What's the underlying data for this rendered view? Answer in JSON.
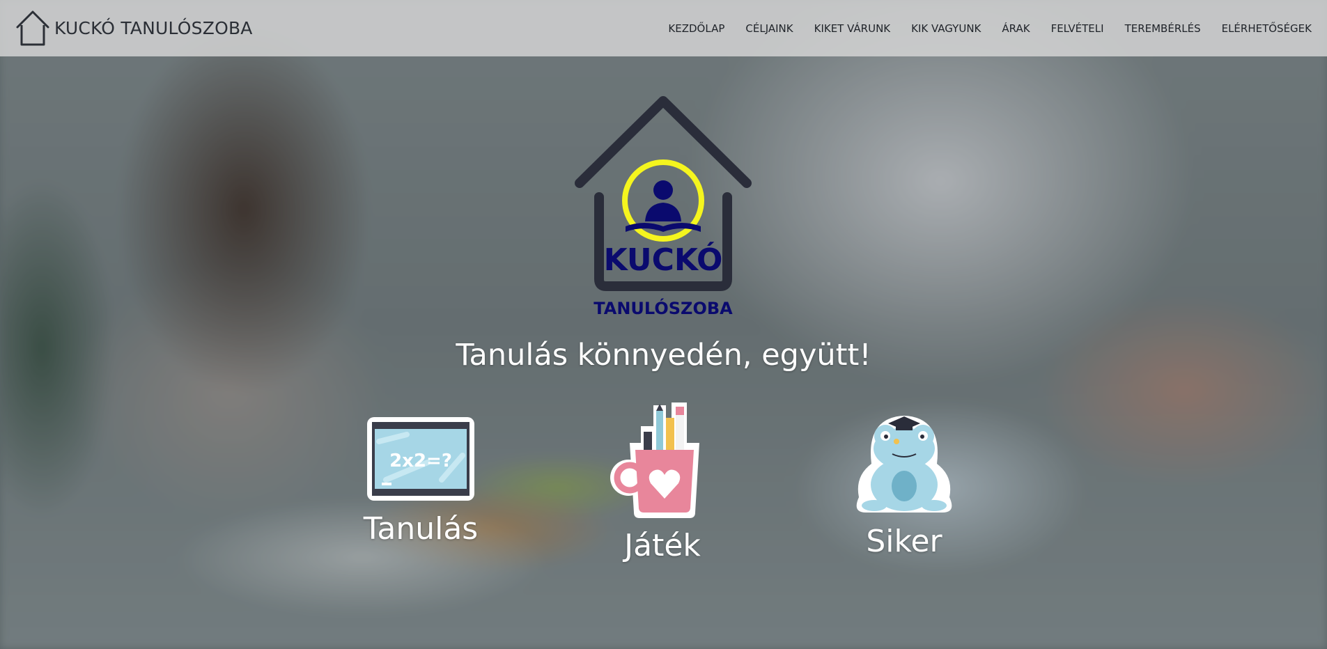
{
  "brand": {
    "name": "KUCKÓ TANULÓSZOBA",
    "icon": "house-icon"
  },
  "nav": {
    "items": [
      {
        "label": "KEZDŐLAP"
      },
      {
        "label": "CÉLJAINK"
      },
      {
        "label": "KIKET VÁRUNK"
      },
      {
        "label": "KIK VAGYUNK"
      },
      {
        "label": "ÁRAK"
      },
      {
        "label": "FELVÉTELI"
      },
      {
        "label": "TEREMBÉRLÉS"
      },
      {
        "label": "ELÉRHETŐSÉGEK"
      }
    ]
  },
  "hero": {
    "logo": {
      "word1": "KUCKÓ",
      "word2": "TANULÓSZOBA"
    },
    "tagline": "Tanulás könnyedén, együtt!",
    "features": [
      {
        "label": "Tanulás",
        "icon": "chalkboard-icon",
        "board_text": "2x2=?"
      },
      {
        "label": "Játék",
        "icon": "pencil-mug-icon"
      },
      {
        "label": "Siker",
        "icon": "graduate-frog-icon"
      }
    ]
  },
  "colors": {
    "navy": "#0a0a6e",
    "charcoal": "#2a2d3a",
    "yellow": "#f5f51e",
    "white": "#ffffff"
  }
}
